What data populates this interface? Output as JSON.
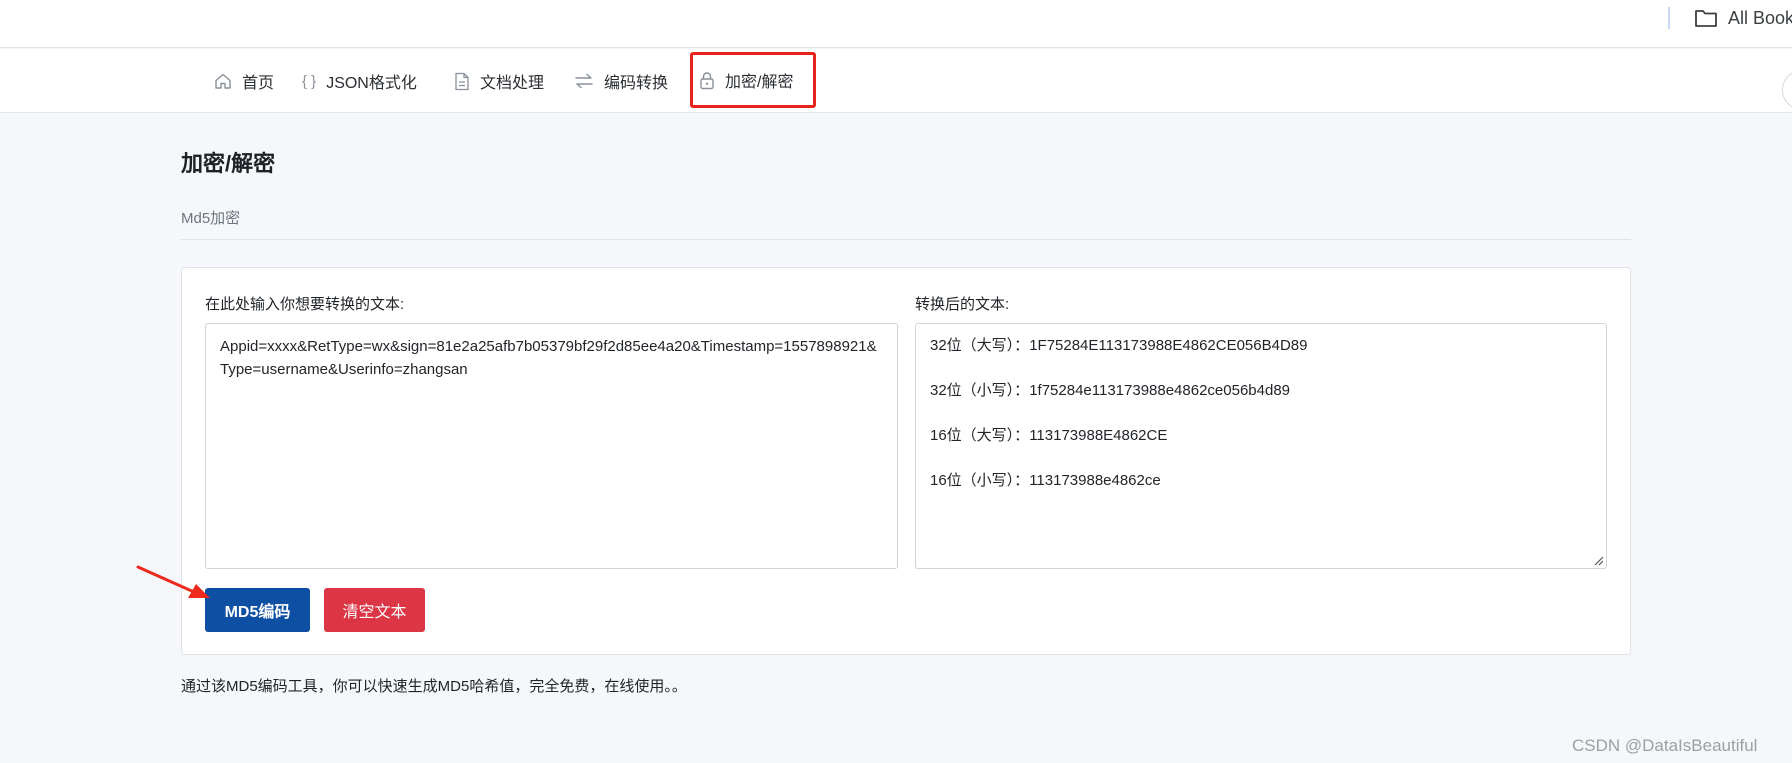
{
  "browser": {
    "bookmarks_label": "All Book"
  },
  "nav": {
    "items": [
      {
        "label": "首页",
        "icon": "home-icon"
      },
      {
        "label": "JSON格式化",
        "icon": "braces-icon",
        "icon_glyph": "{ }"
      },
      {
        "label": "文档处理",
        "icon": "document-icon"
      },
      {
        "label": "编码转换",
        "icon": "exchange-icon"
      },
      {
        "label": "加密/解密",
        "icon": "lock-icon",
        "active": true
      }
    ],
    "highlight_color": "#e8231c"
  },
  "page": {
    "title": "加密/解密",
    "subtitle": "Md5加密"
  },
  "converter": {
    "input_label": "在此处输入你想要转换的文本:",
    "input_value": "Appid=xxxx&RetType=wx&sign=81e2a25afb7b05379bf29f2d85ee4a20&Timestamp=1557898921&Type=username&Userinfo=zhangsan",
    "output_label": "转换后的文本:",
    "results": [
      {
        "label": "32位（大写）：",
        "value": "1F75284E113173988E4862CE056B4D89"
      },
      {
        "label": "32位（小写）：",
        "value": "1f75284e113173988e4862ce056b4d89"
      },
      {
        "label": "16位（大写）：",
        "value": "113173988E4862CE"
      },
      {
        "label": "16位（小写）：",
        "value": "113173988e4862ce"
      }
    ],
    "encode_button": "MD5编码",
    "clear_button": "清空文本"
  },
  "colors": {
    "primary": "#0d4fa3",
    "danger": "#dc3545",
    "annotation_arrow": "#ee2a1c"
  },
  "footer": {
    "note": "通过该MD5编码工具，你可以快速生成MD5哈希值，完全免费，在线使用。。"
  },
  "watermark": "CSDN @DataIsBeautiful"
}
